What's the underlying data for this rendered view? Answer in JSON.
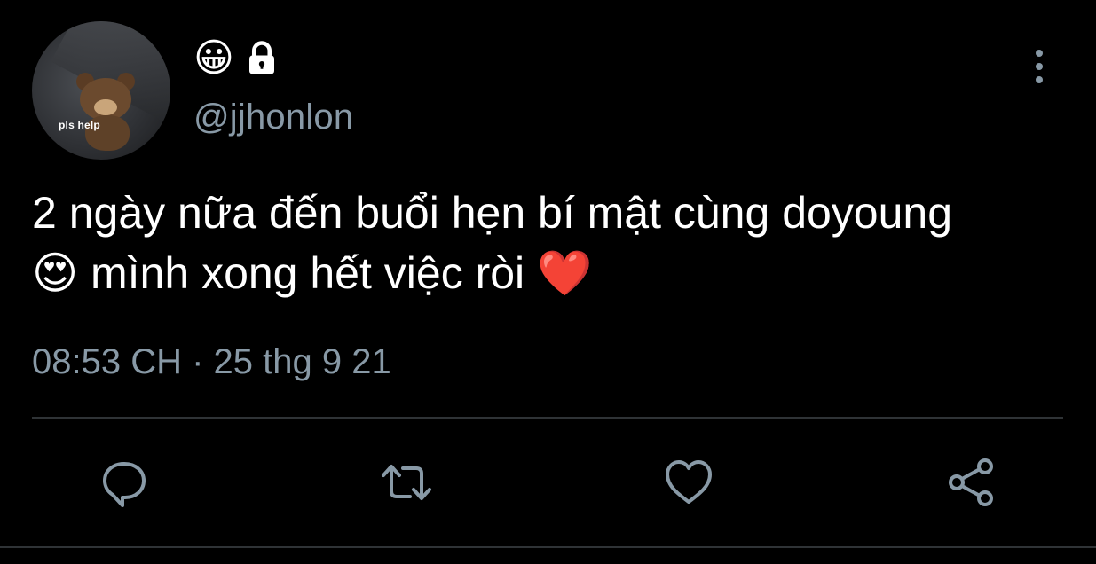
{
  "avatar": {
    "caption": "pls help"
  },
  "user": {
    "display_name_emoji": "😀",
    "handle": "@jjhonlon",
    "protected_icon": "lock-icon"
  },
  "tweet": {
    "text": "2 ngày nữa đến buổi hẹn bí mật cùng doyoung 😍 mình xong hết việc ròi ❤️",
    "timestamp": "08:53 CH · 25 thg 9 21"
  },
  "actions": {
    "reply_icon": "reply-icon",
    "retweet_icon": "retweet-icon",
    "like_icon": "heart-icon",
    "share_icon": "share-icon"
  },
  "colors": {
    "background": "#000000",
    "text": "#ffffff",
    "muted": "#8899a6",
    "divider": "#2f3336"
  }
}
